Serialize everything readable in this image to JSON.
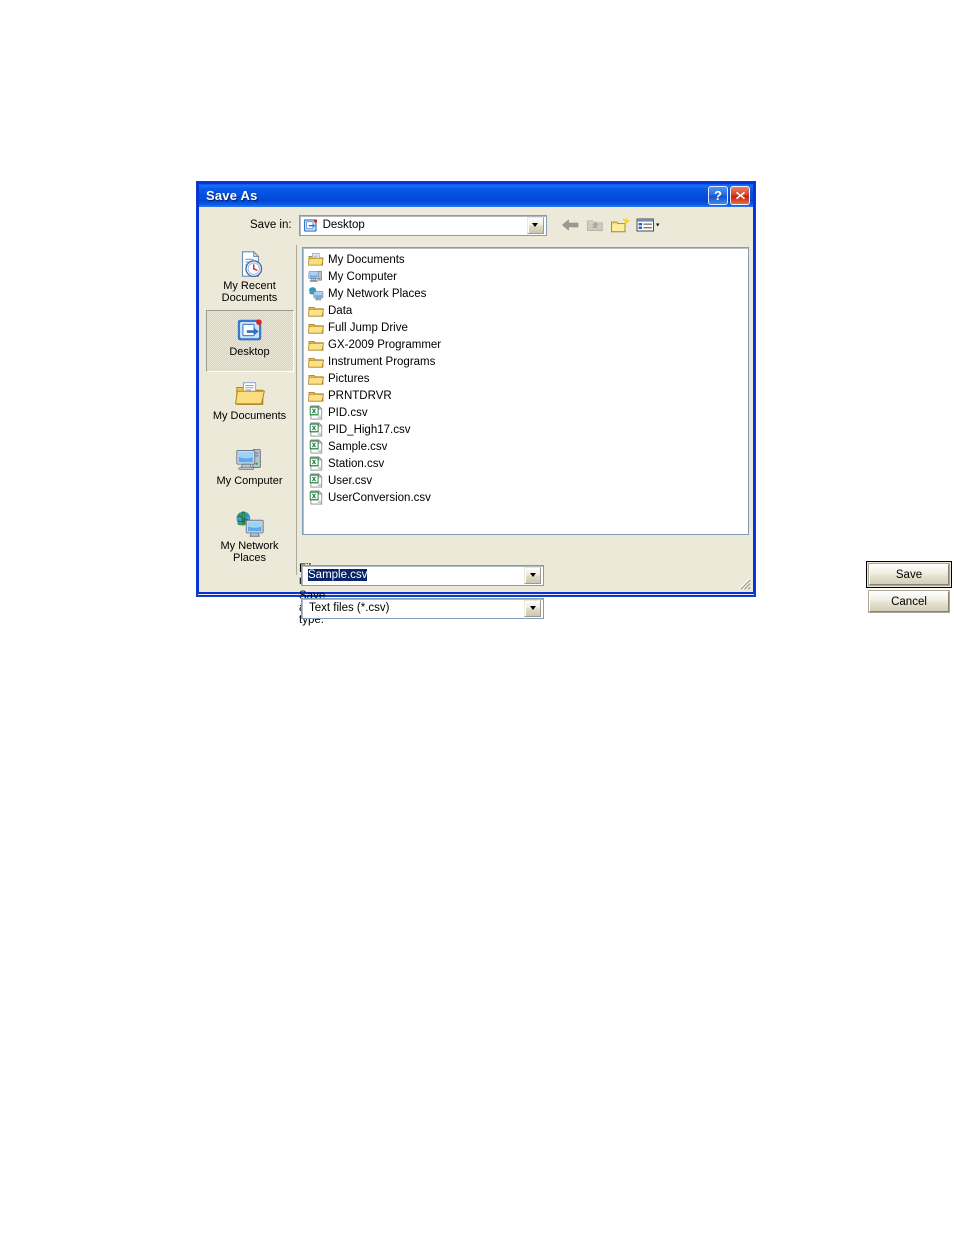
{
  "window": {
    "title": "Save As",
    "help_button": "?",
    "close_button": "✕",
    "help_icon": "question-mark-icon",
    "close_icon": "close-x-icon"
  },
  "toolbar": {
    "savein_label": "Save in:",
    "savein_value": "Desktop",
    "savein_icon": "desktop-icon",
    "buttons": [
      {
        "name": "back-button",
        "icon": "back-arrow-icon",
        "enabled": false
      },
      {
        "name": "up-one-level-button",
        "icon": "up-folder-icon",
        "enabled": false
      },
      {
        "name": "create-new-folder-button",
        "icon": "new-folder-icon",
        "enabled": true
      },
      {
        "name": "views-button",
        "icon": "views-list-icon",
        "enabled": true
      }
    ]
  },
  "places": [
    {
      "label": "My Recent\nDocuments",
      "icon": "recent-documents-icon",
      "selected": false
    },
    {
      "label": "Desktop",
      "icon": "desktop-icon",
      "selected": true
    },
    {
      "label": "My Documents",
      "icon": "my-documents-folder-icon",
      "selected": false
    },
    {
      "label": "My Computer",
      "icon": "my-computer-icon",
      "selected": false
    },
    {
      "label": "My Network\nPlaces",
      "icon": "my-network-places-icon",
      "selected": false
    }
  ],
  "file_list": [
    {
      "name": "My Documents",
      "icon": "my-documents-folder-icon"
    },
    {
      "name": "My Computer",
      "icon": "my-computer-icon"
    },
    {
      "name": "My Network Places",
      "icon": "my-network-places-icon"
    },
    {
      "name": "Data",
      "icon": "folder-icon"
    },
    {
      "name": "Full Jump Drive",
      "icon": "folder-icon"
    },
    {
      "name": "GX-2009 Programmer",
      "icon": "folder-icon"
    },
    {
      "name": "Instrument Programs",
      "icon": "folder-icon"
    },
    {
      "name": "Pictures",
      "icon": "folder-icon"
    },
    {
      "name": "PRNTDRVR",
      "icon": "folder-icon"
    },
    {
      "name": "PID.csv",
      "icon": "csv-file-icon"
    },
    {
      "name": "PID_High17.csv",
      "icon": "csv-file-icon"
    },
    {
      "name": "Sample.csv",
      "icon": "csv-file-icon"
    },
    {
      "name": "Station.csv",
      "icon": "csv-file-icon"
    },
    {
      "name": "User.csv",
      "icon": "csv-file-icon"
    },
    {
      "name": "UserConversion.csv",
      "icon": "csv-file-icon"
    }
  ],
  "fields": {
    "filename_label": "File name:",
    "filename_value": "Sample.csv",
    "filename_selected": true,
    "savetype_label": "Save as type:",
    "savetype_value": "Text files (*.csv)"
  },
  "actions": {
    "save_label": "Save",
    "cancel_label": "Cancel",
    "default_button": "Save"
  },
  "colors": {
    "title_bar_blue": "#0558e6",
    "dialog_face": "#ece9d8",
    "border_blue": "#0831d9",
    "selection_blue": "#0a246a",
    "field_border": "#7f9db9",
    "close_red": "#d9452a"
  }
}
